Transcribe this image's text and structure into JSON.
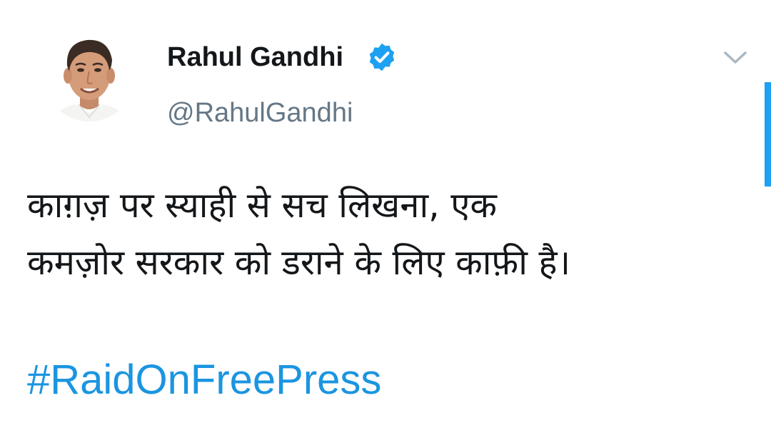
{
  "tweet": {
    "author": {
      "name": "Rahul Gandhi",
      "handle": "@RahulGandhi",
      "verified": true,
      "verified_icon": "verified-badge-icon",
      "avatar": "profile-photo"
    },
    "menu_icon": "chevron-down-icon",
    "text_lines": [
      "काग़ज़ पर स्याही से सच लिखना, एक",
      "कमज़ोर सरकार को डराने के लिए काफ़ी है।"
    ],
    "hashtag": "#RaidOnFreePress"
  },
  "colors": {
    "name": "#14171a",
    "handle": "#657786",
    "link": "#1b95e0",
    "verified": "#1da1f2",
    "scrollbar": "#1da1f2",
    "caret": "#aab8c2"
  }
}
